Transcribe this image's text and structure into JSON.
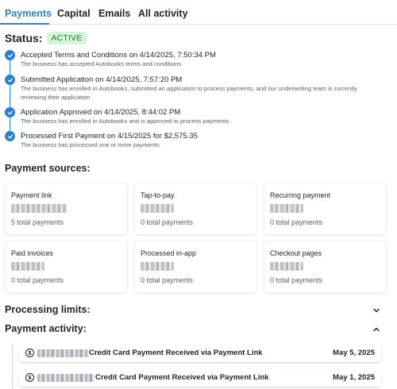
{
  "tabs": [
    {
      "label": "Payments",
      "active": true
    },
    {
      "label": "Capital",
      "active": false
    },
    {
      "label": "Emails",
      "active": false
    },
    {
      "label": "All activity",
      "active": false
    }
  ],
  "status": {
    "label": "Status:",
    "badge": "ACTIVE"
  },
  "timeline": [
    {
      "title": "Accepted Terms and Conditions on 4/14/2025, 7:50:34 PM",
      "description": "The business has accepted Autobooks terms and conditions"
    },
    {
      "title": "Submitted Application on 4/14/2025, 7:57:20 PM",
      "description": "The business has enrolled in Autobooks, submitted an application to process payments, and our underwriting team is currently reviewing their application"
    },
    {
      "title": "Application Approved on 4/14/2025, 8:44:02 PM",
      "description": "The business has enrolled in Autobooks and is approved to process payments"
    },
    {
      "title": "Processed First Payment on 4/15/2025 for $2,575.35",
      "description": "The business has processed one or more payments"
    }
  ],
  "payment_sources": {
    "heading": "Payment sources:",
    "cards": [
      {
        "title": "Payment link",
        "count": "5 total payments"
      },
      {
        "title": "Tap-to-pay",
        "count": "0 total payments"
      },
      {
        "title": "Recurring payment",
        "count": "0 total payments"
      },
      {
        "title": "Paid invoices",
        "count": "0 total payments"
      },
      {
        "title": "Processed in-app",
        "count": "0 total payments"
      },
      {
        "title": "Checkout pages",
        "count": "0 total payments"
      }
    ]
  },
  "processing_limits": {
    "heading": "Processing limits:",
    "expanded": false
  },
  "payment_activity": {
    "heading": "Payment activity:",
    "expanded": true,
    "items": [
      {
        "text": "Credit Card Payment Received via Payment Link",
        "date": "May 5, 2025"
      },
      {
        "text": "Credit Card Payment Received via Payment Link",
        "date": "May 1, 2025"
      }
    ]
  },
  "colors": {
    "accent": "#2f80c8",
    "badge_bg": "#d8f5dc",
    "badge_text": "#1e7a35"
  }
}
